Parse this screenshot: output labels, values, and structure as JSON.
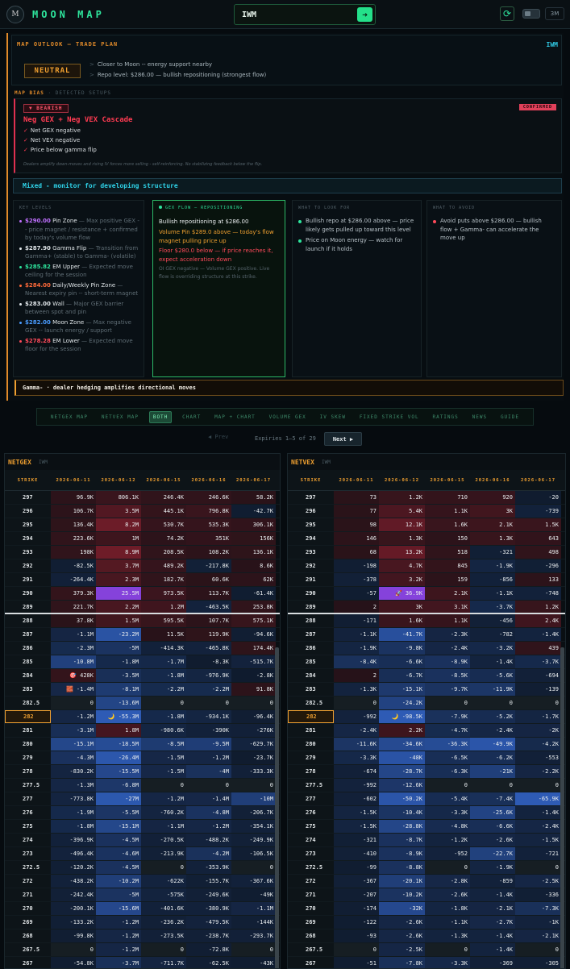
{
  "app": {
    "logo_text": "M",
    "title": "MOON MAP"
  },
  "search": {
    "value": "IWM",
    "go_icon": "arrow-right"
  },
  "controls": {
    "timeframe": "3M"
  },
  "outlook": {
    "title": "MAP OUTLOOK — TRADE PLAN",
    "ticker": "IWM",
    "badge": "NEUTRAL",
    "lines": [
      "Closer to Moon -- energy support nearby",
      "Repo level: $286.00 — bullish repositioning (strongest flow)"
    ]
  },
  "bias": {
    "title": "MAP BIAS",
    "subtitle": "· DETECTED SETUPS",
    "direction": "▼ BEARISH",
    "status": "CONFIRMED",
    "name": "Neg GEX + Neg VEX Cascade",
    "checks": [
      "Net GEX negative",
      "Net VEX negative",
      "Price below gamma flip"
    ],
    "description": "Dealers amplify down-moves and rising IV forces more selling - self-reinforcing. No stabilizing feedback below the flip."
  },
  "mixed": "Mixed - monitor for developing structure",
  "key_levels": {
    "title": "KEY LEVELS",
    "items": [
      {
        "value": "$290.00",
        "label": "Pin Zone",
        "desc": "— Max positive GEX - - price magnet / resistance + confirmed by today's volume flow",
        "color": "#c070ff"
      },
      {
        "value": "$287.90",
        "label": "Gamma Flip",
        "desc": "— Transition from Gamma+ (stable) to Gamma- (volatile)",
        "color": "#dfe5e8"
      },
      {
        "value": "$285.82",
        "label": "EM Upper",
        "desc": "— Expected move ceiling for the session",
        "color": "#2ee59d"
      },
      {
        "value": "$284.00",
        "label": "Daily/Weekly Pin Zone",
        "desc": "— Nearest expiry pin -- short-term magnet",
        "color": "#ff6a3a"
      },
      {
        "value": "$283.00",
        "label": "Wall",
        "desc": "— Major GEX barrier between spot and pin",
        "color": "#dfe5e8"
      },
      {
        "value": "$282.00",
        "label": "Moon Zone",
        "desc": "— Max negative GEX -- launch energy / support",
        "color": "#4a9cff"
      },
      {
        "value": "$278.28",
        "label": "EM Lower",
        "desc": "— Expected move floor for the session",
        "color": "#ff4a5a"
      }
    ]
  },
  "gex_flow": {
    "title": "GEX FLOW — REPOSITIONING",
    "line1": "Bullish repositioning at $286.00",
    "line2": "Volume Pin $289.0 above — today's flow magnet pulling price up",
    "line3": "Floor $280.0 below — if price reaches it, expect acceleration down",
    "line4": "OI GEX negative — Volume GEX positive. Live flow is overriding structure at this strike."
  },
  "look_for": {
    "title": "WHAT TO LOOK FOR",
    "items": [
      "Bullish repo at $286.00 above — price likely gets pulled up toward this level",
      "Price on Moon energy — watch for launch if it holds"
    ]
  },
  "avoid": {
    "title": "WHAT TO AVOID",
    "items": [
      "Avoid puts above $286.00 — bullish flow + Gamma- can accelerate the move up"
    ]
  },
  "gamma_note": "Gamma- · dealer hedging amplifies directional moves",
  "tabs": [
    "NETGEX MAP",
    "NETVEX MAP",
    "BOTH",
    "CHART",
    "MAP + CHART",
    "VOLUME GEX",
    "IV SKEW",
    "FIXED STRIKE VOL",
    "RATINGS",
    "NEWS",
    "GUIDE"
  ],
  "active_tab": "BOTH",
  "pager": {
    "prev": "◀ Prev",
    "expiries": "Expiries 1–5 of 29",
    "next": "Next ▶"
  },
  "expiries": [
    "2026-06-11",
    "2026-06-12",
    "2026-06-15",
    "2026-06-16",
    "2026-06-17"
  ],
  "strike_header": "STRIKE",
  "netgex": {
    "title": "NETGEX",
    "ticker": "IWM",
    "rows": [
      [
        "297",
        "96.9K",
        "806.1K",
        "246.4K",
        "246.6K",
        "58.2K"
      ],
      [
        "296",
        "106.7K",
        "3.5M",
        "445.1K",
        "796.8K",
        "-42.7K"
      ],
      [
        "295",
        "136.4K",
        "8.2M",
        "530.7K",
        "535.3K",
        "306.1K"
      ],
      [
        "294",
        "223.6K",
        "1M",
        "74.2K",
        "351K",
        "156K"
      ],
      [
        "293",
        "198K",
        "8.9M",
        "208.5K",
        "108.2K",
        "136.1K"
      ],
      [
        "292",
        "-82.5K",
        "3.7M",
        "489.2K",
        "-217.8K",
        "8.6K"
      ],
      [
        "291",
        "-264.4K",
        "2.3M",
        "182.7K",
        "60.6K",
        "62K"
      ],
      [
        "290",
        "379.3K",
        "25.5M",
        "973.5K",
        "113.7K",
        "-61.4K"
      ],
      [
        "289",
        "221.7K",
        "2.2M",
        "1.2M",
        "-463.5K",
        "253.8K"
      ],
      [
        "288",
        "37.8K",
        "1.5M",
        "595.5K",
        "107.7K",
        "575.1K"
      ],
      [
        "287",
        "-1.1M",
        "-23.2M",
        "11.5K",
        "119.9K",
        "-94.6K"
      ],
      [
        "286",
        "-2.3M",
        "-5M",
        "-414.3K",
        "-465.8K",
        "174.4K"
      ],
      [
        "285",
        "-10.8M",
        "-1.8M",
        "-1.7M",
        "-8.3K",
        "-515.7K"
      ],
      [
        "284",
        "🎯 428K",
        "-3.5M",
        "-1.8M",
        "-976.9K",
        "-2.8K"
      ],
      [
        "283",
        "🧱 -1.4M",
        "-8.1M",
        "-2.2M",
        "-2.2M",
        "91.8K"
      ],
      [
        "282.5",
        "0",
        "-13.6M",
        "0",
        "0",
        "0"
      ],
      [
        "282",
        "-1.2M",
        "🌙 -55.3M",
        "-1.8M",
        "-934.1K",
        "-96.4K"
      ],
      [
        "281",
        "-3.1M",
        "1.8M",
        "-980.6K",
        "-390K",
        "-276K"
      ],
      [
        "280",
        "-15.1M",
        "-18.5M",
        "-8.5M",
        "-9.5M",
        "-629.7K"
      ],
      [
        "279",
        "-4.3M",
        "-26.4M",
        "-1.5M",
        "-1.2M",
        "-23.7K"
      ],
      [
        "278",
        "-830.2K",
        "-15.5M",
        "-1.5M",
        "-4M",
        "-333.3K"
      ],
      [
        "277.5",
        "-1.3M",
        "-6.8M",
        "0",
        "0",
        "0"
      ],
      [
        "277",
        "-773.8K",
        "-27M",
        "-1.2M",
        "-1.4M",
        "-10M"
      ],
      [
        "276",
        "-1.9M",
        "-5.5M",
        "-760.2K",
        "-4.8M",
        "-206.7K"
      ],
      [
        "275",
        "-1.8M",
        "-15.1M",
        "-1.1M",
        "-1.2M",
        "-354.1K"
      ],
      [
        "274",
        "-396.9K",
        "-4.5M",
        "-270.5K",
        "-488.2K",
        "-249.9K"
      ],
      [
        "273",
        "-496.4K",
        "-4.6M",
        "-213.9K",
        "-4.2M",
        "-106.5K"
      ],
      [
        "272.5",
        "-120.2K",
        "-4.5M",
        "0",
        "-353.9K",
        "0"
      ],
      [
        "272",
        "-438.2K",
        "-10.2M",
        "-622K",
        "-155.7K",
        "-367.6K"
      ],
      [
        "271",
        "-242.4K",
        "-5M",
        "-575K",
        "-249.6K",
        "-49K"
      ],
      [
        "270",
        "-200.1K",
        "-15.6M",
        "-401.6K",
        "-380.9K",
        "-1.1M"
      ],
      [
        "269",
        "-133.2K",
        "-1.2M",
        "-236.2K",
        "-479.5K",
        "-144K"
      ],
      [
        "268",
        "-99.8K",
        "-1.2M",
        "-273.5K",
        "-238.7K",
        "-293.7K"
      ],
      [
        "267.5",
        "0",
        "-1.2M",
        "0",
        "-72.8K",
        "0"
      ],
      [
        "267",
        "-54.8K",
        "-3.7M",
        "-711.7K",
        "-62.5K",
        "-43K"
      ]
    ]
  },
  "netvex": {
    "title": "NETVEX",
    "ticker": "IWM",
    "rows": [
      [
        "297",
        "73",
        "1.2K",
        "710",
        "920",
        "-20"
      ],
      [
        "296",
        "77",
        "5.4K",
        "1.1K",
        "3K",
        "-739"
      ],
      [
        "295",
        "98",
        "12.1K",
        "1.6K",
        "2.1K",
        "1.5K"
      ],
      [
        "294",
        "146",
        "1.3K",
        "150",
        "1.3K",
        "643"
      ],
      [
        "293",
        "68",
        "13.2K",
        "518",
        "-321",
        "498"
      ],
      [
        "292",
        "-198",
        "4.7K",
        "845",
        "-1.9K",
        "-296"
      ],
      [
        "291",
        "-378",
        "3.2K",
        "159",
        "-856",
        "133"
      ],
      [
        "290",
        "-57",
        "🚀 36.9K",
        "2.1K",
        "-1.1K",
        "-748"
      ],
      [
        "289",
        "2",
        "3K",
        "3.1K",
        "-3.7K",
        "1.2K"
      ],
      [
        "288",
        "-171",
        "1.6K",
        "1.1K",
        "-456",
        "2.4K"
      ],
      [
        "287",
        "-1.1K",
        "-41.7K",
        "-2.3K",
        "-782",
        "-1.4K"
      ],
      [
        "286",
        "-1.9K",
        "-9.8K",
        "-2.4K",
        "-3.2K",
        "439"
      ],
      [
        "285",
        "-8.4K",
        "-6.6K",
        "-8.9K",
        "-1.4K",
        "-3.7K"
      ],
      [
        "284",
        "2",
        "-6.7K",
        "-8.5K",
        "-5.6K",
        "-694"
      ],
      [
        "283",
        "-1.3K",
        "-15.1K",
        "-9.7K",
        "-11.9K",
        "-139"
      ],
      [
        "282.5",
        "0",
        "-24.2K",
        "0",
        "0",
        "0"
      ],
      [
        "282",
        "-992",
        "🌙 -98.5K",
        "-7.9K",
        "-5.2K",
        "-1.7K"
      ],
      [
        "281",
        "-2.4K",
        "2.2K",
        "-4.7K",
        "-2.4K",
        "-2K"
      ],
      [
        "280",
        "-11.6K",
        "-34.6K",
        "-36.3K",
        "-49.9K",
        "-4.2K"
      ],
      [
        "279",
        "-3.3K",
        "-48K",
        "-6.5K",
        "-6.2K",
        "-553"
      ],
      [
        "278",
        "-674",
        "-28.7K",
        "-6.3K",
        "-21K",
        "-2.2K"
      ],
      [
        "277.5",
        "-992",
        "-12.6K",
        "0",
        "0",
        "0"
      ],
      [
        "277",
        "-602",
        "-50.2K",
        "-5.4K",
        "-7.4K",
        "-65.9K"
      ],
      [
        "276",
        "-1.5K",
        "-10.4K",
        "-3.3K",
        "-25.6K",
        "-1.4K"
      ],
      [
        "275",
        "-1.5K",
        "-28.8K",
        "-4.8K",
        "-6.6K",
        "-2.4K"
      ],
      [
        "274",
        "-321",
        "-8.7K",
        "-1.2K",
        "-2.6K",
        "-1.5K"
      ],
      [
        "273",
        "-410",
        "-8.9K",
        "-952",
        "-22.7K",
        "-721"
      ],
      [
        "272.5",
        "-99",
        "-8.8K",
        "0",
        "-1.9K",
        "0"
      ],
      [
        "272",
        "-367",
        "-20.1K",
        "-2.8K",
        "-859",
        "-2.5K"
      ],
      [
        "271",
        "-207",
        "-10.2K",
        "-2.6K",
        "-1.4K",
        "-336"
      ],
      [
        "270",
        "-174",
        "-32K",
        "-1.8K",
        "-2.1K",
        "-7.3K"
      ],
      [
        "269",
        "-122",
        "-2.6K",
        "-1.1K",
        "-2.7K",
        "-1K"
      ],
      [
        "268",
        "-93",
        "-2.6K",
        "-1.3K",
        "-1.4K",
        "-2.1K"
      ],
      [
        "267.5",
        "0",
        "-2.5K",
        "0",
        "-1.4K",
        "0"
      ],
      [
        "267",
        "-51",
        "-7.8K",
        "-3.3K",
        "-369",
        "-305"
      ]
    ]
  },
  "selected_strike": "282"
}
